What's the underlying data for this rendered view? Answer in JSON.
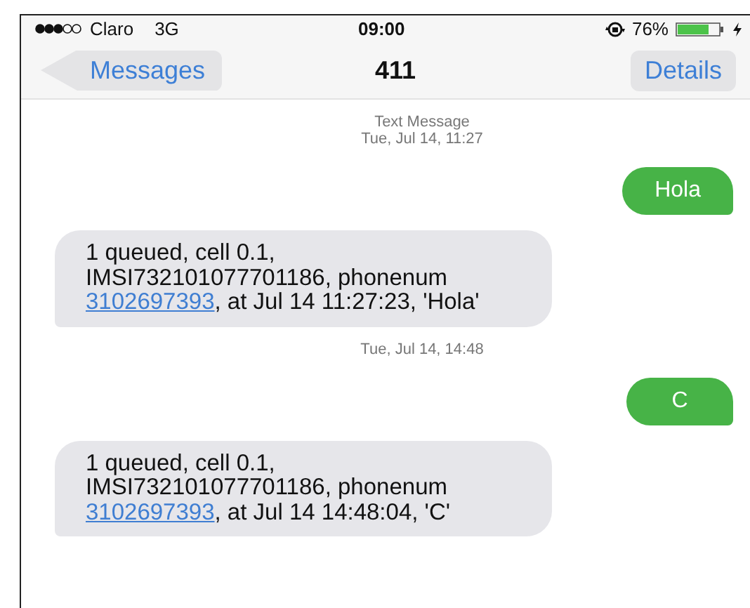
{
  "status_bar": {
    "carrier": "Claro",
    "network": "3G",
    "time": "09:00",
    "battery": "76%"
  },
  "nav": {
    "back": "Messages",
    "title": "411",
    "action": "Details"
  },
  "messages": [
    {
      "kind": "timestamp",
      "label": "Text Message",
      "time": "Tue, Jul 14, 11:27"
    },
    {
      "kind": "sent",
      "text": "Hola"
    },
    {
      "kind": "received",
      "before": "1 queued, cell 0.1, IMSI732101077701186, phonenum ",
      "link": "3102697393",
      "after": ", at Jul 14 11:27:23, 'Hola'"
    },
    {
      "kind": "timestamp",
      "time": "Tue, Jul 14, 14:48"
    },
    {
      "kind": "sent",
      "text": "C"
    },
    {
      "kind": "received",
      "before": "1 queued, cell 0.1, IMSI732101077701186, phonenum ",
      "link": "3102697393",
      "after": ", at Jul 14 14:48:04, 'C'"
    }
  ]
}
